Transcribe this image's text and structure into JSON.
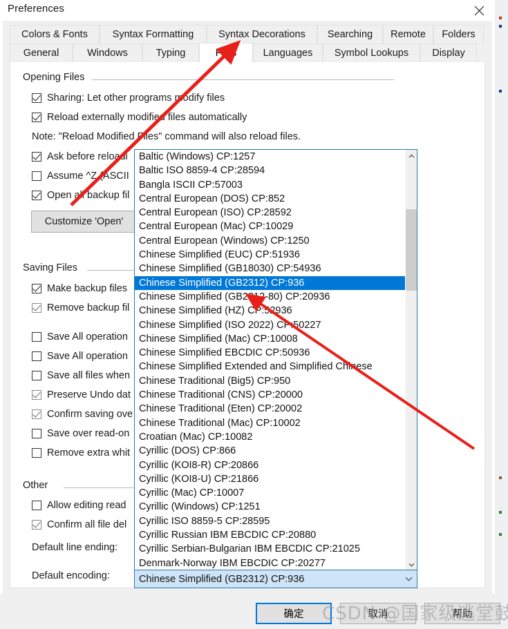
{
  "window": {
    "title": "Preferences",
    "close_icon": "close-icon"
  },
  "tabs": {
    "row1": [
      {
        "label": "Colors & Fonts",
        "selected": false
      },
      {
        "label": "Syntax Formatting",
        "selected": false
      },
      {
        "label": "Syntax Decorations",
        "selected": false
      },
      {
        "label": "Searching",
        "selected": false
      },
      {
        "label": "Remote",
        "selected": false
      },
      {
        "label": "Folders",
        "selected": false
      }
    ],
    "row2": [
      {
        "label": "General",
        "selected": false
      },
      {
        "label": "Windows",
        "selected": false
      },
      {
        "label": "Typing",
        "selected": false
      },
      {
        "label": "Files",
        "selected": true
      },
      {
        "label": "Languages",
        "selected": false
      },
      {
        "label": "Symbol Lookups",
        "selected": false
      },
      {
        "label": "Display",
        "selected": false
      }
    ]
  },
  "groups": {
    "opening_files": {
      "label": "Opening Files",
      "items": [
        {
          "label": "Sharing: Let other programs modify files",
          "checked": true
        },
        {
          "label": "Reload externally modified files automatically",
          "checked": true
        }
      ],
      "note": "Note: \"Reload Modified Files\" command will also reload files.",
      "items2": [
        {
          "label": "Ask before reloadi",
          "checked": true
        },
        {
          "label": "Assume ^Z (ASCII",
          "checked": false
        },
        {
          "label": "Open all backup fil",
          "checked": true
        }
      ],
      "button": "Customize 'Open'"
    },
    "saving_files": {
      "label": "Saving Files",
      "items": [
        {
          "label": "Make backup files",
          "checked": true
        },
        {
          "label": "Remove backup fil",
          "checked": true
        },
        {
          "label": "Save All operation",
          "checked": false
        },
        {
          "label": "Save All operation",
          "checked": false
        },
        {
          "label": "Save all files when",
          "checked": false
        },
        {
          "label": "Preserve Undo dat",
          "checked": true
        },
        {
          "label": "Confirm saving ove",
          "checked": true
        },
        {
          "label": "Save over read-on",
          "checked": false
        },
        {
          "label": "Remove extra whit",
          "checked": false
        }
      ]
    },
    "other": {
      "label": "Other",
      "items": [
        {
          "label": "Allow editing read",
          "checked": false
        },
        {
          "label": "Confirm all file del",
          "checked": true
        }
      ],
      "line_ending_label": "Default line ending:",
      "encoding_label": "Default encoding:"
    }
  },
  "encoding_combo": {
    "value": "Chinese Simplified (GB2312)  CP:936",
    "arrow_icon": "chevron-down-icon",
    "scroll_up_icon": "chevron-up-icon",
    "scroll_down_icon": "chevron-down-icon",
    "options": [
      "Baltic (Windows)  CP:1257",
      "Baltic ISO 8859-4   CP:28594",
      "Bangla ISCII  CP:57003",
      "Central European (DOS)  CP:852",
      "Central European (ISO)  CP:28592",
      "Central European (Mac)  CP:10029",
      "Central European (Windows)  CP:1250",
      "Chinese Simplified (EUC)  CP:51936",
      "Chinese Simplified (GB18030)  CP:54936",
      "Chinese Simplified (GB2312)  CP:936",
      "Chinese Simplified (GB2312-80)  CP:20936",
      "Chinese Simplified (HZ)  CP:52936",
      "Chinese Simplified (ISO 2022)  CP:50227",
      "Chinese Simplified (Mac)  CP:10008",
      "Chinese Simplified EBCDIC  CP:50936",
      "Chinese Simplified Extended and Simplified Chinese",
      "Chinese Traditional (Big5)  CP:950",
      "Chinese Traditional (CNS)  CP:20000",
      "Chinese Traditional (Eten)  CP:20002",
      "Chinese Traditional (Mac)  CP:10002",
      "Croatian (Mac)  CP:10082",
      "Cyrillic (DOS)  CP:866",
      "Cyrillic (KOI8-R)  CP:20866",
      "Cyrillic (KOI8-U)  CP:21866",
      "Cyrillic (Mac)  CP:10007",
      "Cyrillic (Windows)  CP:1251",
      "Cyrillic ISO 8859-5   CP:28595",
      "Cyrillic Russian IBM EBCDIC  CP:20880",
      "Cyrillic Serbian-Bulgarian IBM EBCDIC  CP:21025",
      "Denmark-Norway IBM EBCDIC  CP:20277"
    ],
    "selected_index": 9
  },
  "footer": {
    "ok": "确定",
    "cancel": "取消",
    "help": "帮助"
  },
  "watermark": "CSDN @国家级逃堂鼓",
  "colors": {
    "selection_blue": "#0078d7",
    "combo_border": "#2a7ab0",
    "combo_fill": "#cfe4f7",
    "annotation_red": "#e8201a",
    "scroll_thumb": "#cdcdcd",
    "button_face": "#e1e1e1"
  }
}
